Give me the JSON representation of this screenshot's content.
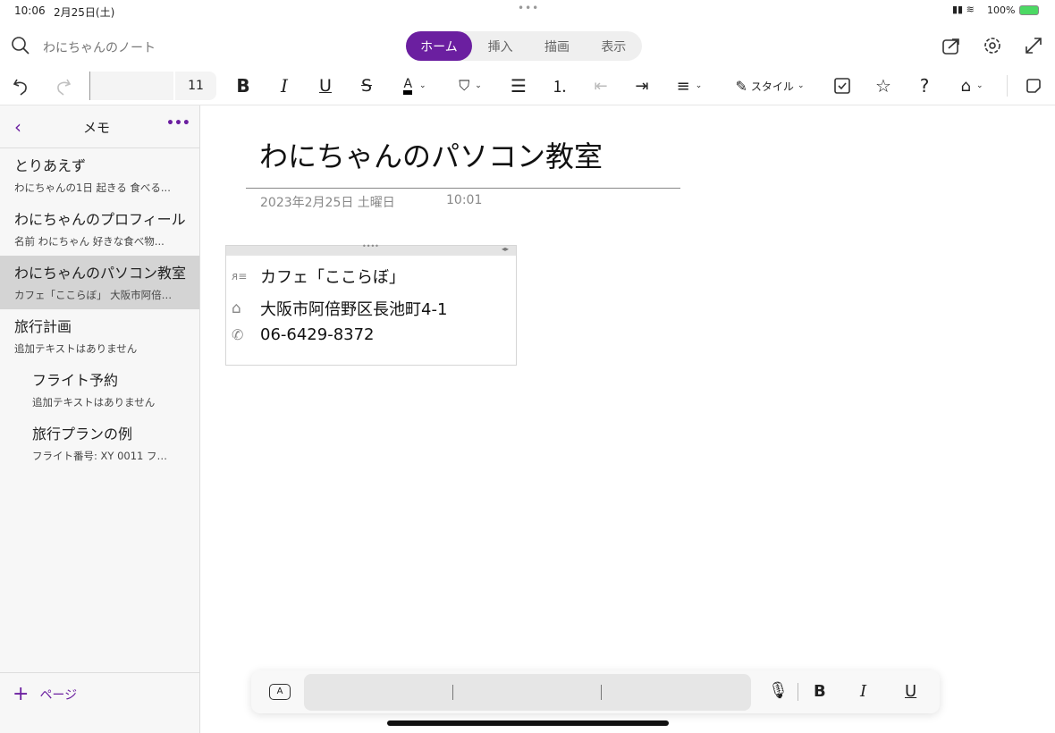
{
  "status": {
    "time": "10:06",
    "date": "2月25日(土)",
    "battery": "100%"
  },
  "header": {
    "notebook": "わにちゃんのノート",
    "tabs": [
      "ホーム",
      "挿入",
      "描画",
      "表示"
    ],
    "active_tab": 0
  },
  "toolbar": {
    "font_name": "",
    "font_size": "11",
    "style_label": "スタイル"
  },
  "sidebar": {
    "title": "メモ",
    "add_page": "ページ",
    "pages": [
      {
        "title": "とりあえず",
        "snippet": "わにちゃんの1日  起きる  食べる...",
        "indent": false,
        "selected": false
      },
      {
        "title": "わにちゃんのプロフィール",
        "snippet": "名前  わにちゃん  好きな食べ物...",
        "indent": false,
        "selected": false
      },
      {
        "title": "わにちゃんのパソコン教室",
        "snippet": "カフェ「ここらぼ」  大阪市阿倍…",
        "indent": false,
        "selected": true
      },
      {
        "title": "旅行計画",
        "snippet": "追加テキストはありません",
        "indent": false,
        "selected": false
      },
      {
        "title": "フライト予約",
        "snippet": "追加テキストはありません",
        "indent": true,
        "selected": false
      },
      {
        "title": "旅行プランの例",
        "snippet": "フライト番号: XY 0011  フ…",
        "indent": true,
        "selected": false
      }
    ]
  },
  "page": {
    "title": "わにちゃんのパソコン教室",
    "date": "2023年2月25日 土曜日",
    "time": "10:01",
    "contact": {
      "name": "カフェ「ここらぼ」",
      "address": "大阪市阿倍野区長池町4-1",
      "phone": "06-6429-8372"
    }
  },
  "colors": {
    "accent": "#6b1fa0"
  }
}
